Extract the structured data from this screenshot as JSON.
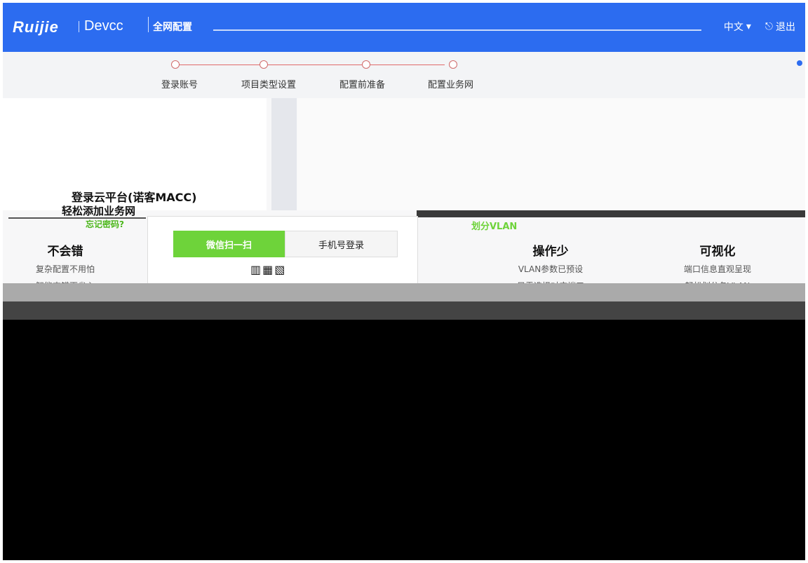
{
  "header": {
    "logo": "Ruijie",
    "brand": "Devcc",
    "title": "全网配置",
    "lang": "中文",
    "logout": "退出"
  },
  "steps": [
    {
      "label": "登录账号"
    },
    {
      "label": "项目类型设置"
    },
    {
      "label": "配置前准备"
    },
    {
      "label": "配置业务网"
    }
  ],
  "login": {
    "title": "登录云平台(诺客MACC)",
    "subtitle": "轻松添加业务网",
    "forgot": "忘记密码?",
    "tabs": [
      {
        "label": "微信扫一扫"
      },
      {
        "label": "手机号登录"
      }
    ]
  },
  "features": [
    {
      "title": "不会错",
      "desc": "复杂配置不用怕",
      "desc2": "智能查错更省心"
    },
    {
      "title": "操作少",
      "desc": "VLAN参数已预设",
      "desc2": "只需选择对应端口"
    },
    {
      "title": "可视化",
      "desc": "端口信息直观呈现",
      "desc2": "轻松划分各VLAN"
    }
  ],
  "banner": {
    "text": "划分VLAN"
  },
  "colors": {
    "brand_blue": "#2c6cf0",
    "accent_green": "#6ed33a"
  }
}
